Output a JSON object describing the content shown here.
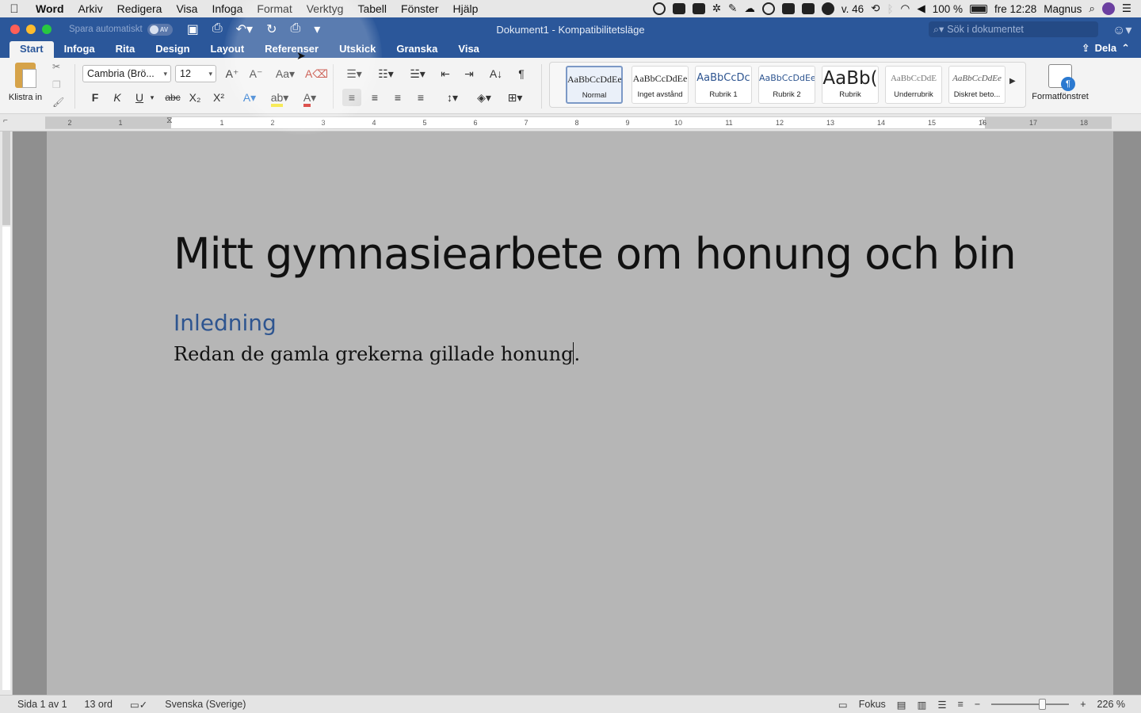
{
  "menubar": {
    "app_name": "Word",
    "items": [
      "Arkiv",
      "Redigera",
      "Visa",
      "Infoga",
      "Format",
      "Verktyg",
      "Tabell",
      "Fönster",
      "Hjälp"
    ],
    "week": "v. 46",
    "battery": "100 %",
    "clock": "fre 12:28",
    "user": "Magnus"
  },
  "titlebar": {
    "autosave_label": "Spara automatiskt",
    "autosave_state": "AV",
    "document_title": "Dokument1  -  Kompatibilitetsläge",
    "search_placeholder": "Sök i dokumentet"
  },
  "ribbon": {
    "tabs": [
      "Start",
      "Infoga",
      "Rita",
      "Design",
      "Layout",
      "Referenser",
      "Utskick",
      "Granska",
      "Visa"
    ],
    "active_tab": "Start",
    "share_label": "Dela",
    "paste_label": "Klistra in",
    "font_name": "Cambria (Brö...",
    "font_size": "12",
    "bold_label": "F",
    "italic_label": "K",
    "underline_label": "U",
    "strike_label": "abc",
    "styles": [
      {
        "preview": "AaBbCcDdEe",
        "name": "Normal"
      },
      {
        "preview": "AaBbCcDdEe",
        "name": "Inget avstånd"
      },
      {
        "preview": "AaBbCcDc",
        "name": "Rubrik 1"
      },
      {
        "preview": "AaBbCcDdEe",
        "name": "Rubrik 2"
      },
      {
        "preview": "AaBb(",
        "name": "Rubrik"
      },
      {
        "preview": "AaBbCcDdE",
        "name": "Underrubrik"
      },
      {
        "preview": "AaBbCcDdEe",
        "name": "Diskret beto..."
      }
    ],
    "styles_pane_label": "Formatfönstret"
  },
  "ruler": {
    "numbers": [
      "2",
      "1",
      "1",
      "2",
      "3",
      "4",
      "5",
      "6",
      "7",
      "8",
      "9",
      "10",
      "11",
      "12",
      "13",
      "14",
      "15",
      "16",
      "17",
      "18"
    ]
  },
  "document": {
    "title": "Mitt gymnasiearbete om honung och bin",
    "heading": "Inledning",
    "body": "Redan de gamla grekerna gillade honung."
  },
  "statusbar": {
    "page": "Sida 1 av 1",
    "words": "13 ord",
    "language": "Svenska (Sverige)",
    "focus_label": "Fokus",
    "zoom": "226 %"
  },
  "colors": {
    "word_blue": "#2b579a",
    "heading_blue": "#2e5590"
  }
}
